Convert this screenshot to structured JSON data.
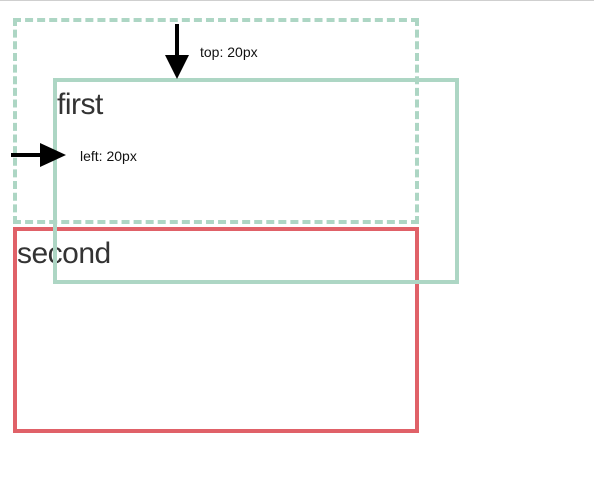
{
  "boxes": {
    "first_label": "first",
    "second_label": "second"
  },
  "offsets": {
    "top_label": "top: 20px",
    "left_label": "left: 20px"
  },
  "colors": {
    "first_border": "#add6c4",
    "second_border": "#e06168",
    "arrow": "#000000"
  },
  "icons": {
    "top_arrow": "arrow-down-icon",
    "left_arrow": "arrow-right-icon"
  }
}
